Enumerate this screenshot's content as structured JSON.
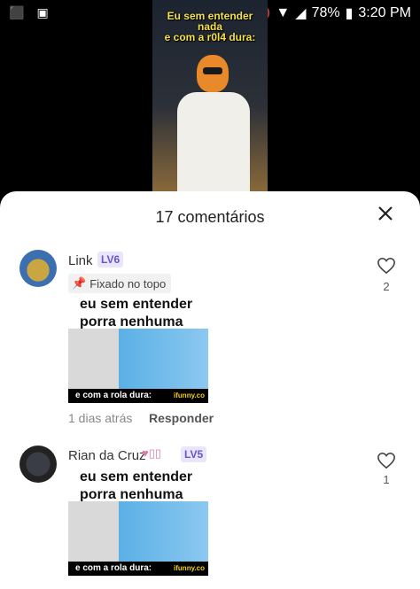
{
  "status_bar": {
    "battery": "78%",
    "time": "3:20 PM"
  },
  "video": {
    "caption": "Eu sem entender\nnada\ne com a r0l4 dura:"
  },
  "sheet": {
    "title": "17 comentários"
  },
  "comments": [
    {
      "username": "Link",
      "level": "LV6",
      "pinned_label": "Fixado no topo",
      "text": "eu sem entender\nporra nenhuma",
      "image_caption": "e   com a rola dura:",
      "image_logo": "ifunny.co",
      "time": "1 dias atrás",
      "reply_label": "Responder",
      "likes": "2"
    },
    {
      "username": "Rian da Cruz",
      "level": "LV5",
      "text": "eu sem entender\nporra nenhuma",
      "image_caption": "e   com a rola dura:",
      "image_logo": "ifunny.co",
      "likes": "1"
    }
  ]
}
